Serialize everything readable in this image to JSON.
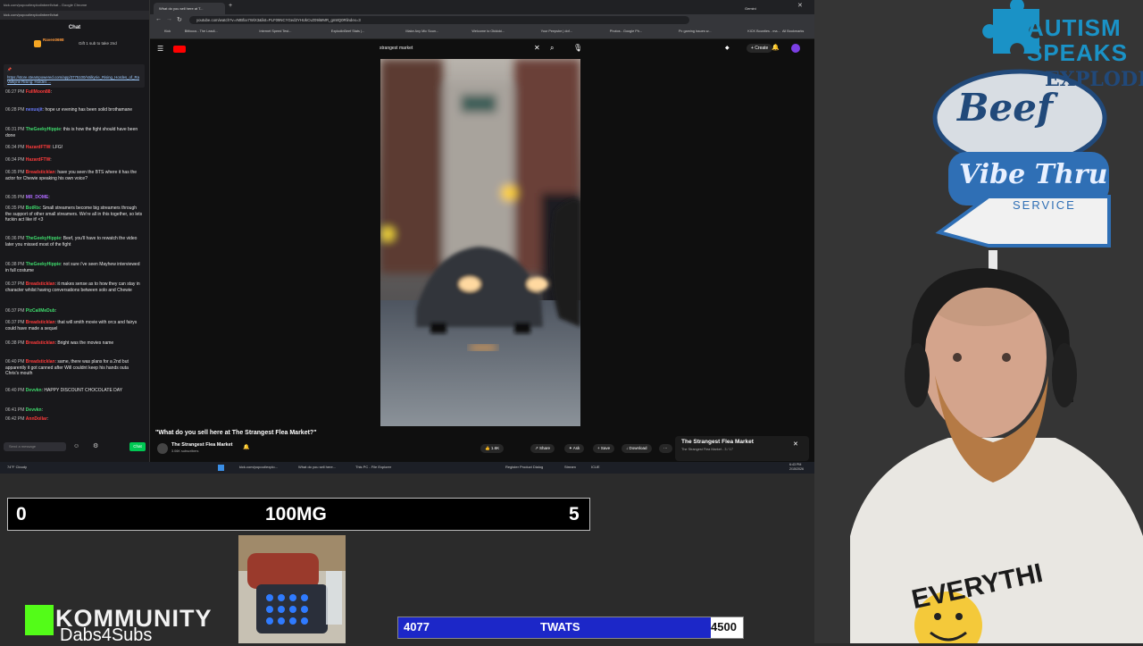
{
  "chat": {
    "window_title": "kick.com/popout/explodinbeef/chat - Google Chrome",
    "url": "kick.com/popout/explodinbeef/chat",
    "header": "Chat",
    "gift_user": "Raven0698",
    "gift_text": "Gift 1 sub to take 2nd",
    "pinned_link": "https://store.steampowered.com/app/3775100/Valkyrie_Rising_Hordes_of_Ragnark_Demo/ Valkyrie Rising: Hordes ...",
    "messages": [
      {
        "time": "06:27 PM",
        "user": "FullMoon88",
        "color": "#ff3b3b",
        "text": ""
      },
      {
        "time": "06:28 PM",
        "user": "nexusjit",
        "color": "#6a7cff",
        "text": "hope ur evening has been solid brothamane"
      },
      {
        "time": "06:31 PM",
        "user": "TheGeekyHippie",
        "color": "#3fdc6d",
        "text": "this is how the fight should have been done"
      },
      {
        "time": "06:34 PM",
        "user": "HazardFTW",
        "color": "#ff3b3b",
        "text": "LFG!"
      },
      {
        "time": "06:34 PM",
        "user": "HazardFTW",
        "color": "#ff3b3b",
        "text": ""
      },
      {
        "time": "06:35 PM",
        "user": "Breadsticklan",
        "color": "#ff3b3b",
        "text": "have you seen the BTS where it has the actor for Chewie speaking his own voice?"
      },
      {
        "time": "06:35 PM",
        "user": "MR_DOME",
        "color": "#b06bff",
        "text": ""
      },
      {
        "time": "06:35 PM",
        "user": "BotRix",
        "color": "#3fdc6d",
        "text": "Small streamers become big streamers through the support of other small streamers. We're all in this together, so lets fuckin act like it! <3"
      },
      {
        "time": "06:36 PM",
        "user": "TheGeekyHippie",
        "color": "#3fdc6d",
        "text": "Beef, you'll have to rewatch the video later you missed most of the fight"
      },
      {
        "time": "06:38 PM",
        "user": "TheGeekyHippie",
        "color": "#3fdc6d",
        "text": "not sure i've seen Mayhew interviewed in full costume"
      },
      {
        "time": "06:37 PM",
        "user": "Breadsticklan",
        "color": "#ff3b3b",
        "text": "it makes sense as to how they can stay in character whilst having conversations between solo and Chewie"
      },
      {
        "time": "06:37 PM",
        "user": "PizCallMeDub",
        "color": "#3fdc6d",
        "text": ""
      },
      {
        "time": "06:37 PM",
        "user": "Breadsticklan",
        "color": "#ff3b3b",
        "text": "that will smith movie with orcs and fairys could have made a sequel"
      },
      {
        "time": "06:38 PM",
        "user": "Breadsticklan",
        "color": "#ff3b3b",
        "text": "Bright was the movies name"
      },
      {
        "time": "06:40 PM",
        "user": "Breadsticklan",
        "color": "#ff3b3b",
        "text": "same, there was plans for a 2nd but apparently it got canned after Will couldnt keep his hands outa Chris's mouth"
      },
      {
        "time": "06:40 PM",
        "user": "Devvkn",
        "color": "#3fdc6d",
        "text": "HAPPY DISCOUNT CHOCOLATE DAY"
      },
      {
        "time": "06:41 PM",
        "user": "Devvkn",
        "color": "#3fdc6d",
        "text": ""
      },
      {
        "time": "06:42 PM",
        "user": "AnnDollar",
        "color": "#ff3b3b",
        "text": ""
      }
    ],
    "input_placeholder": "Send a message",
    "send_label": "Chat"
  },
  "browser": {
    "tabs": [
      "What do you sell here at T...",
      "Gemini"
    ],
    "url": "youtube.com/watch?v=rMBfxx7WiX3&list=PLF09NCYGed2YHUkCvZ09iMMR_gm8Q0Rlindex=3",
    "bookmarks": [
      "Kick",
      "Bitfocus - The Leadi...",
      "Internet Speed Test...",
      "ExplodinBeef Stats |...",
      "Make Any Mic Soun...",
      "Welcome to Okidoki...",
      "Your Peepsbe | dof...",
      "Photos - Google Ph...",
      "Pc gaming issues w...",
      "KICK Bounties - ma...",
      "MybeatsmI | The be...",
      "Criminal Gallery by k...",
      "All Bookmarks"
    ],
    "search_query": "strangest market",
    "video_title": "\"What do you sell here at The Strangest Flea Market?\"",
    "channel_name": "The Strangest Flea Market",
    "channel_subs": "3.06K subscribers",
    "like_count": "1.6K",
    "share_label": "Share",
    "ask_label": "Ask",
    "save_label": "Save",
    "download_label": "Download",
    "playlist_title": "The Strangest Flea Market",
    "playlist_sub": "The Strangest Flea Market - 3 / 17"
  },
  "taskbar": {
    "weather": "74°F Cloudy",
    "items": [
      "kick.com/popout/explo...",
      "What do you sell here...",
      "This PC - File Explorer",
      "Register Product Dialog",
      "Stream",
      "ICUE"
    ],
    "time": "6:43 PM",
    "date": "2/15/2026"
  },
  "overlay": {
    "counter_left": "0",
    "counter_mid": "100MG",
    "counter_right": "5",
    "brand_line1": "KOMMUNITY",
    "brand_line2": "Dabs4Subs",
    "goal_current": "4077",
    "goal_label": "TWATS",
    "goal_target": "4500",
    "goal_fraction": 0.906,
    "goal_color": "#1c27c8"
  },
  "branding": {
    "autism_line1": "AUTISM",
    "autism_line2": "SPEAKS",
    "sign_line1": "EXPLODIN",
    "sign_line2": "Beef",
    "sign_line3": "Vibe Thru",
    "sign_line4": "SERVICE",
    "shirt_text": "EVERYTHI"
  },
  "colors": {
    "autism_blue": "#1a92c6",
    "kick_green": "#53fc18",
    "send_green": "#00c853"
  }
}
